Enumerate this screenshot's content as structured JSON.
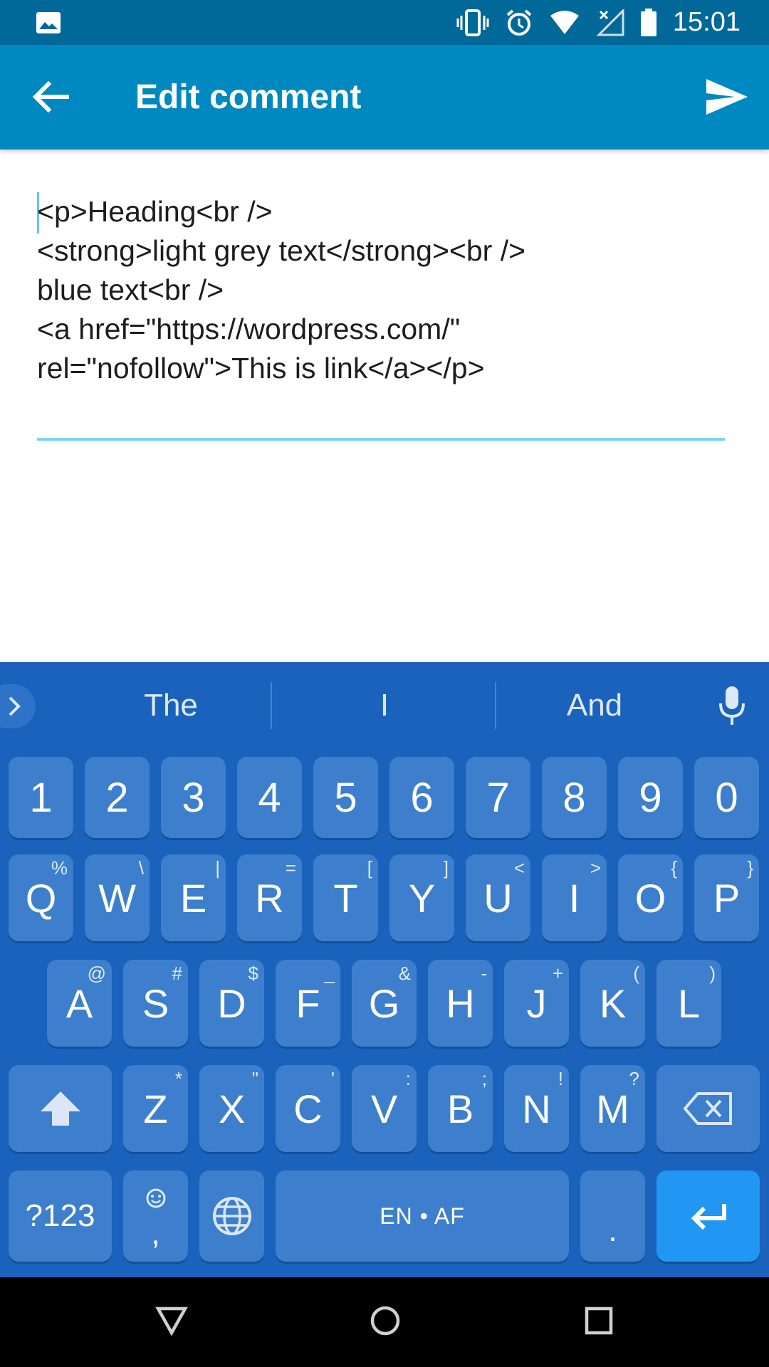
{
  "status_bar": {
    "time": "15:01",
    "icons": [
      "image-icon",
      "vibrate-icon",
      "alarm-icon",
      "wifi-icon",
      "no-signal-icon",
      "battery-icon"
    ]
  },
  "app_bar": {
    "title": "Edit comment",
    "back_icon": "arrow-back-icon",
    "send_icon": "send-icon"
  },
  "editor": {
    "value": "<p>Heading<br />\n<strong>light grey text</strong><br />\nblue text<br />\n<a href=\"https://wordpress.com/\"\nrel=\"nofollow\">This is link</a></p>"
  },
  "keyboard": {
    "suggestions": [
      "The",
      "I",
      "And"
    ],
    "number_row": [
      "1",
      "2",
      "3",
      "4",
      "5",
      "6",
      "7",
      "8",
      "9",
      "0"
    ],
    "row1": [
      {
        "key": "Q",
        "sub": "%"
      },
      {
        "key": "W",
        "sub": "\\"
      },
      {
        "key": "E",
        "sub": "|"
      },
      {
        "key": "R",
        "sub": "="
      },
      {
        "key": "T",
        "sub": "["
      },
      {
        "key": "Y",
        "sub": "]"
      },
      {
        "key": "U",
        "sub": "<"
      },
      {
        "key": "I",
        "sub": ">"
      },
      {
        "key": "O",
        "sub": "{"
      },
      {
        "key": "P",
        "sub": "}"
      }
    ],
    "row2": [
      {
        "key": "A",
        "sub": "@"
      },
      {
        "key": "S",
        "sub": "#"
      },
      {
        "key": "D",
        "sub": "$"
      },
      {
        "key": "F",
        "sub": "_"
      },
      {
        "key": "G",
        "sub": "&"
      },
      {
        "key": "H",
        "sub": "-"
      },
      {
        "key": "J",
        "sub": "+"
      },
      {
        "key": "K",
        "sub": "("
      },
      {
        "key": "L",
        "sub": ")"
      }
    ],
    "row3": [
      {
        "key": "Z",
        "sub": "*"
      },
      {
        "key": "X",
        "sub": "\""
      },
      {
        "key": "C",
        "sub": "'"
      },
      {
        "key": "V",
        "sub": ":"
      },
      {
        "key": "B",
        "sub": ";"
      },
      {
        "key": "N",
        "sub": "!"
      },
      {
        "key": "M",
        "sub": "?"
      }
    ],
    "symbols_label": "?123",
    "comma_label": ",",
    "space_label": "EN • AF",
    "period_label": ".",
    "accent_color": "#2196f3",
    "background_color": "#1a62bc"
  },
  "nav_bar": {
    "icons": [
      "back-triangle-icon",
      "home-circle-icon",
      "recents-square-icon"
    ]
  }
}
